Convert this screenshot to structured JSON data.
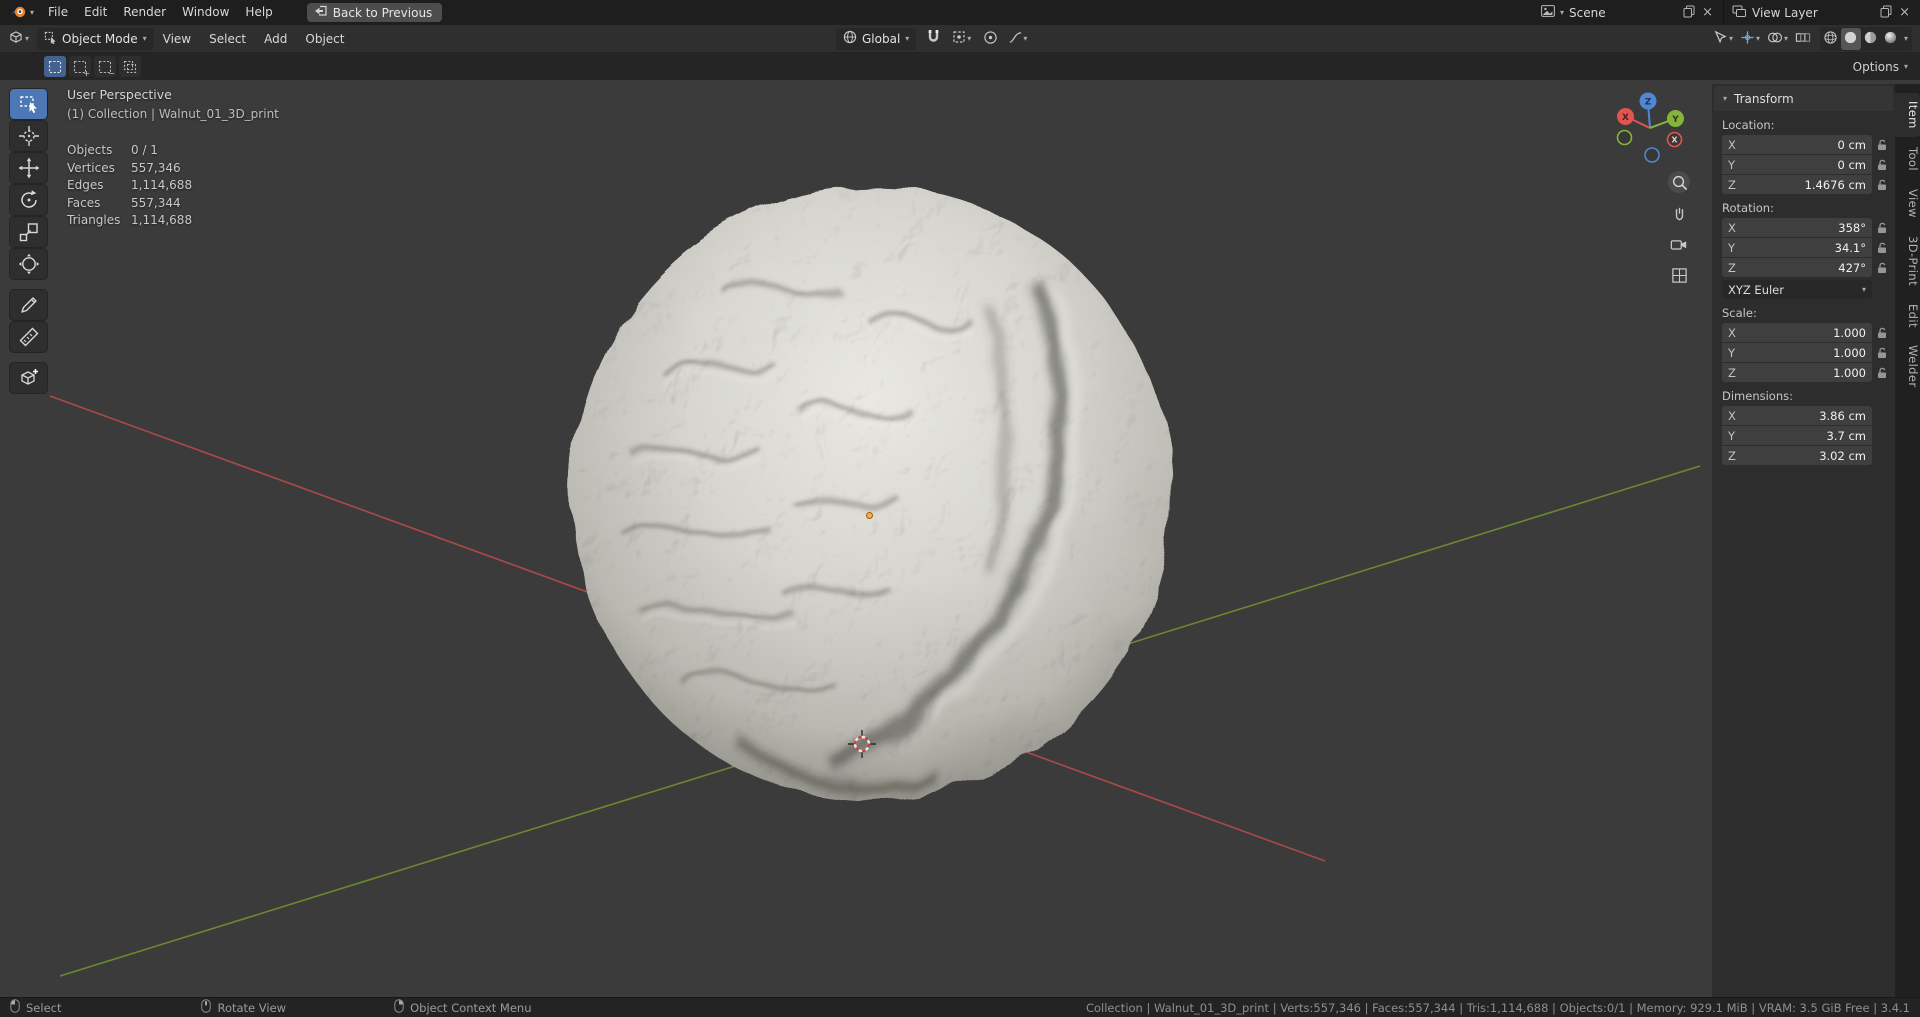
{
  "topbar": {
    "menus": [
      "File",
      "Edit",
      "Render",
      "Window",
      "Help"
    ],
    "back_button": "Back to Previous",
    "scene_label": "Scene",
    "view_layer_label": "View Layer"
  },
  "header": {
    "mode": "Object Mode",
    "menus": [
      "View",
      "Select",
      "Add",
      "Object"
    ],
    "orientation": "Global",
    "options_label": "Options"
  },
  "viewport": {
    "view_name": "User Perspective",
    "context": "(1) Collection | Walnut_01_3D_print",
    "stats": [
      {
        "label": "Objects",
        "value": "0 / 1"
      },
      {
        "label": "Vertices",
        "value": "557,346"
      },
      {
        "label": "Edges",
        "value": "1,114,688"
      },
      {
        "label": "Faces",
        "value": "557,344"
      },
      {
        "label": "Triangles",
        "value": "1,114,688"
      }
    ],
    "gizmo_axes": {
      "x": "X",
      "y": "Y",
      "z": "Z"
    }
  },
  "sidebar": {
    "panel_title": "Transform",
    "location": {
      "label": "Location:",
      "rows": [
        {
          "axis": "X",
          "value": "0 cm"
        },
        {
          "axis": "Y",
          "value": "0 cm"
        },
        {
          "axis": "Z",
          "value": "1.4676 cm"
        }
      ]
    },
    "rotation": {
      "label": "Rotation:",
      "rows": [
        {
          "axis": "X",
          "value": "358°"
        },
        {
          "axis": "Y",
          "value": "34.1°"
        },
        {
          "axis": "Z",
          "value": "427°"
        }
      ],
      "mode": "XYZ Euler"
    },
    "scale": {
      "label": "Scale:",
      "rows": [
        {
          "axis": "X",
          "value": "1.000"
        },
        {
          "axis": "Y",
          "value": "1.000"
        },
        {
          "axis": "Z",
          "value": "1.000"
        }
      ]
    },
    "dimensions": {
      "label": "Dimensions:",
      "rows": [
        {
          "axis": "X",
          "value": "3.86 cm"
        },
        {
          "axis": "Y",
          "value": "3.7 cm"
        },
        {
          "axis": "Z",
          "value": "3.02 cm"
        }
      ]
    },
    "tabs": [
      "Item",
      "Tool",
      "View",
      "3D-Print",
      "Edit",
      "Welder"
    ],
    "active_tab": "Item"
  },
  "statusbar": {
    "hints": [
      "Select",
      "Rotate View",
      "Object Context Menu"
    ],
    "info": "Collection | Walnut_01_3D_print | Verts:557,346 | Faces:557,344 | Tris:1,114,688 | Objects:0/1 | Memory: 929.1 MiB | VRAM: 3.5 GiB Free | 3.4.1"
  },
  "colors": {
    "axis_x": "#e0564f",
    "axis_y": "#84b43c",
    "axis_z": "#4f87d6",
    "active_tool": "#4d77b5"
  }
}
